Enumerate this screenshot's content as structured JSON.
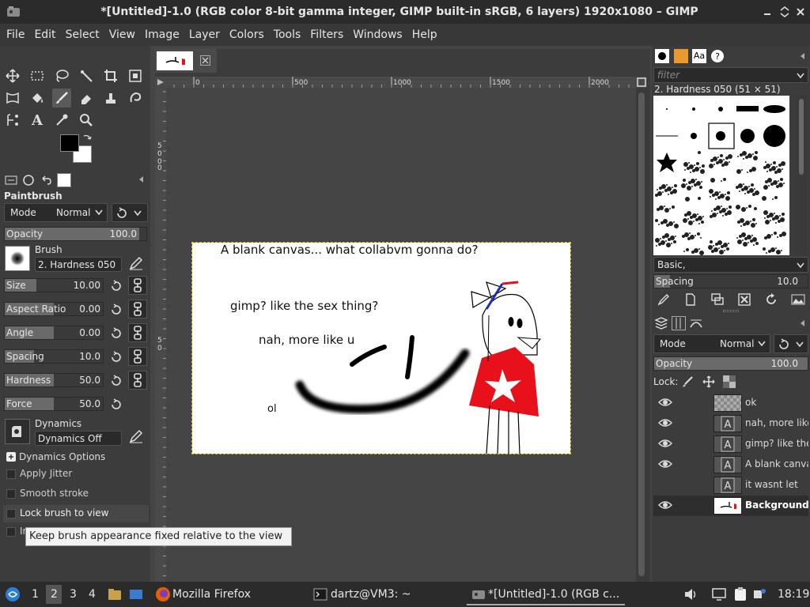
{
  "window": {
    "title": "*[Untitled]-1.0 (RGB color 8-bit gamma integer, GIMP built-in sRGB, 6 layers) 1920x1080 – GIMP"
  },
  "menu": [
    "File",
    "Edit",
    "Select",
    "View",
    "Image",
    "Layer",
    "Colors",
    "Tools",
    "Filters",
    "Windows",
    "Help"
  ],
  "tool_options": {
    "title": "Paintbrush",
    "mode_label": "Mode",
    "mode_value": "Normal",
    "opacity": {
      "label": "Opacity",
      "value": "100.0",
      "fraction": 1.0
    },
    "brush_label": "Brush",
    "brush_value": "2. Hardness 050",
    "sliders": [
      {
        "label": "Size",
        "value": "10.00",
        "fraction": 0.32
      },
      {
        "label": "Aspect Ratio",
        "value": "0.00",
        "fraction": 0.5
      },
      {
        "label": "Angle",
        "value": "0.00",
        "fraction": 0.5
      },
      {
        "label": "Spacing",
        "value": "10.0",
        "fraction": 0.3
      },
      {
        "label": "Hardness",
        "value": "50.0",
        "fraction": 0.5
      },
      {
        "label": "Force",
        "value": "50.0",
        "fraction": 0.5
      }
    ],
    "dynamics_label": "Dynamics",
    "dynamics_value": "Dynamics Off",
    "dynamics_options": "Dynamics Options",
    "options": [
      "Apply Jitter",
      "Smooth stroke",
      "Lock brush to view",
      "Ir"
    ]
  },
  "tooltip": "Keep brush appearance fixed relative to the view",
  "rulers": {
    "h_ticks": [
      "0",
      "500",
      "1000",
      "1500",
      "2000"
    ],
    "v_ticks": [
      "5",
      "0",
      "0",
      "0",
      "5",
      "0"
    ]
  },
  "canvas": {
    "texts": [
      "A blank canvas... what collabvm gonna do?",
      "gimp? like the sex thing?",
      "nah, more like u",
      "ol"
    ]
  },
  "brushes": {
    "filter_placeholder": "filter",
    "selected": "2. Hardness 050 (51 × 51)",
    "tag": "Basic,",
    "spacing": {
      "label": "Spacing",
      "value": "10.0"
    }
  },
  "layers_panel": {
    "mode_label": "Mode",
    "mode_value": "Normal",
    "opacity": {
      "label": "Opacity",
      "value": "100.0"
    },
    "lock_label": "Lock:",
    "layers": [
      {
        "name": "ok",
        "visible": true,
        "type": "transparent"
      },
      {
        "name": "nah, more like",
        "visible": true,
        "type": "text"
      },
      {
        "name": "gimp? like the",
        "visible": true,
        "type": "text"
      },
      {
        "name": "A blank canva",
        "visible": true,
        "type": "text"
      },
      {
        "name": "it wasnt let",
        "visible": false,
        "type": "text"
      },
      {
        "name": "Background",
        "visible": true,
        "type": "image",
        "active": true
      }
    ]
  },
  "taskbar": {
    "workspaces": [
      "1",
      "2",
      "3",
      "4"
    ],
    "active_workspace": "2",
    "tasks": [
      "Mozilla Firefox",
      "dartz@VM3: ~",
      "*[Untitled]-1.0 (RGB c..."
    ],
    "clock": "18:19"
  },
  "colors": {
    "fg": "#000000",
    "bg": "#ffffff",
    "accent_red": "#e8101a"
  }
}
